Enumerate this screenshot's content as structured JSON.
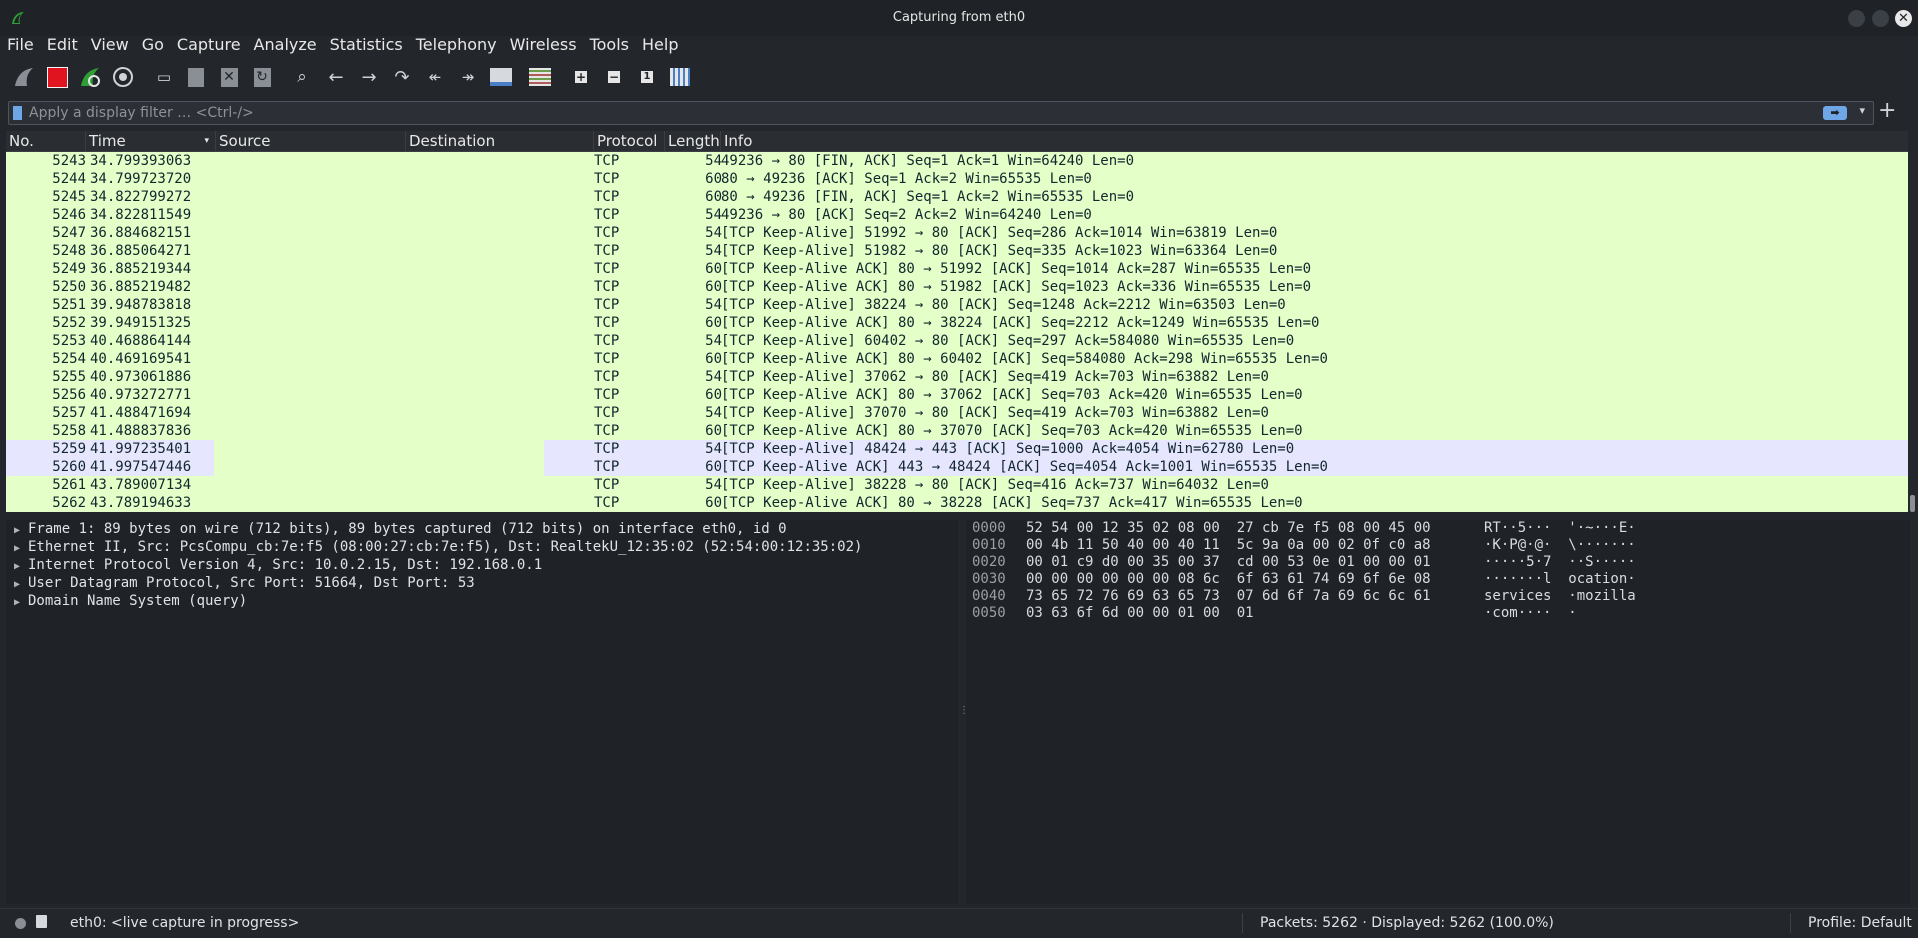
{
  "window": {
    "title": "Capturing from eth0"
  },
  "menu": [
    "File",
    "Edit",
    "View",
    "Go",
    "Capture",
    "Analyze",
    "Statistics",
    "Telephony",
    "Wireless",
    "Tools",
    "Help"
  ],
  "toolbar": {
    "icons": [
      "shark-fin-start-icon",
      "stop-capture-icon",
      "restart-capture-icon",
      "capture-options-icon",
      "open-file-icon",
      "save-file-icon",
      "close-file-icon",
      "reload-file-icon",
      "find-packet-icon",
      "go-back-icon",
      "go-forward-icon",
      "go-to-packet-icon",
      "first-packet-icon",
      "last-packet-icon",
      "autoscroll-icon",
      "colorize-icon",
      "zoom-in-icon",
      "zoom-out-icon",
      "normal-size-icon",
      "resize-columns-icon"
    ]
  },
  "filter": {
    "placeholder": "Apply a display filter … <Ctrl-/>"
  },
  "columns": {
    "no": "No.",
    "time": "Time",
    "source": "Source",
    "destination": "Destination",
    "protocol": "Protocol",
    "length": "Length",
    "info": "Info"
  },
  "packets": [
    {
      "no": "5243",
      "time": "34.799393063",
      "src": "",
      "dst": "",
      "proto": "TCP",
      "len": "54",
      "info": "49236 → 80 [FIN, ACK] Seq=1 Ack=1 Win=64240 Len=0"
    },
    {
      "no": "5244",
      "time": "34.799723720",
      "src": "",
      "dst": "",
      "proto": "TCP",
      "len": "60",
      "info": "80 → 49236 [ACK] Seq=1 Ack=2 Win=65535 Len=0"
    },
    {
      "no": "5245",
      "time": "34.822799272",
      "src": "",
      "dst": "",
      "proto": "TCP",
      "len": "60",
      "info": "80 → 49236 [FIN, ACK] Seq=1 Ack=2 Win=65535 Len=0"
    },
    {
      "no": "5246",
      "time": "34.822811549",
      "src": "",
      "dst": "",
      "proto": "TCP",
      "len": "54",
      "info": "49236 → 80 [ACK] Seq=2 Ack=2 Win=64240 Len=0"
    },
    {
      "no": "5247",
      "time": "36.884682151",
      "src": "",
      "dst": "",
      "proto": "TCP",
      "len": "54",
      "info": "[TCP Keep-Alive] 51992 → 80 [ACK] Seq=286 Ack=1014 Win=63819 Len=0"
    },
    {
      "no": "5248",
      "time": "36.885064271",
      "src": "",
      "dst": "",
      "proto": "TCP",
      "len": "54",
      "info": "[TCP Keep-Alive] 51982 → 80 [ACK] Seq=335 Ack=1023 Win=63364 Len=0"
    },
    {
      "no": "5249",
      "time": "36.885219344",
      "src": "",
      "dst": "",
      "proto": "TCP",
      "len": "60",
      "info": "[TCP Keep-Alive ACK] 80 → 51992 [ACK] Seq=1014 Ack=287 Win=65535 Len=0"
    },
    {
      "no": "5250",
      "time": "36.885219482",
      "src": "",
      "dst": "",
      "proto": "TCP",
      "len": "60",
      "info": "[TCP Keep-Alive ACK] 80 → 51982 [ACK] Seq=1023 Ack=336 Win=65535 Len=0"
    },
    {
      "no": "5251",
      "time": "39.948783818",
      "src": "",
      "dst": "",
      "proto": "TCP",
      "len": "54",
      "info": "[TCP Keep-Alive] 38224 → 80 [ACK] Seq=1248 Ack=2212 Win=63503 Len=0"
    },
    {
      "no": "5252",
      "time": "39.949151325",
      "src": "",
      "dst": "",
      "proto": "TCP",
      "len": "60",
      "info": "[TCP Keep-Alive ACK] 80 → 38224 [ACK] Seq=2212 Ack=1249 Win=65535 Len=0"
    },
    {
      "no": "5253",
      "time": "40.468864144",
      "src": "",
      "dst": "",
      "proto": "TCP",
      "len": "54",
      "info": "[TCP Keep-Alive] 60402 → 80 [ACK] Seq=297 Ack=584080 Win=65535 Len=0"
    },
    {
      "no": "5254",
      "time": "40.469169541",
      "src": "",
      "dst": "",
      "proto": "TCP",
      "len": "60",
      "info": "[TCP Keep-Alive ACK] 80 → 60402 [ACK] Seq=584080 Ack=298 Win=65535 Len=0"
    },
    {
      "no": "5255",
      "time": "40.973061886",
      "src": "",
      "dst": "",
      "proto": "TCP",
      "len": "54",
      "info": "[TCP Keep-Alive] 37062 → 80 [ACK] Seq=419 Ack=703 Win=63882 Len=0"
    },
    {
      "no": "5256",
      "time": "40.973272771",
      "src": "",
      "dst": "",
      "proto": "TCP",
      "len": "60",
      "info": "[TCP Keep-Alive ACK] 80 → 37062 [ACK] Seq=703 Ack=420 Win=65535 Len=0"
    },
    {
      "no": "5257",
      "time": "41.488471694",
      "src": "",
      "dst": "",
      "proto": "TCP",
      "len": "54",
      "info": "[TCP Keep-Alive] 37070 → 80 [ACK] Seq=419 Ack=703 Win=63882 Len=0"
    },
    {
      "no": "5258",
      "time": "41.488837836",
      "src": "",
      "dst": "",
      "proto": "TCP",
      "len": "60",
      "info": "[TCP Keep-Alive ACK] 80 → 37070 [ACK] Seq=703 Ack=420 Win=65535 Len=0"
    },
    {
      "no": "5259",
      "time": "41.997235401",
      "src": "",
      "dst": "",
      "proto": "TCP",
      "len": "54",
      "info": "[TCP Keep-Alive] 48424 → 443 [ACK] Seq=1000 Ack=4054 Win=62780 Len=0",
      "hl": true
    },
    {
      "no": "5260",
      "time": "41.997547446",
      "src": "",
      "dst": "",
      "proto": "TCP",
      "len": "60",
      "info": "[TCP Keep-Alive ACK] 443 → 48424 [ACK] Seq=4054 Ack=1001 Win=65535 Len=0",
      "hl": true
    },
    {
      "no": "5261",
      "time": "43.789007134",
      "src": "",
      "dst": "",
      "proto": "TCP",
      "len": "54",
      "info": "[TCP Keep-Alive] 38228 → 80 [ACK] Seq=416 Ack=737 Win=64032 Len=0"
    },
    {
      "no": "5262",
      "time": "43.789194633",
      "src": "",
      "dst": "",
      "proto": "TCP",
      "len": "60",
      "info": "[TCP Keep-Alive ACK] 80 → 38228 [ACK] Seq=737 Ack=417 Win=65535 Len=0"
    }
  ],
  "details": [
    "Frame 1: 89 bytes on wire (712 bits), 89 bytes captured (712 bits) on interface eth0, id 0",
    "Ethernet II, Src: PcsCompu_cb:7e:f5 (08:00:27:cb:7e:f5), Dst: RealtekU_12:35:02 (52:54:00:12:35:02)",
    "Internet Protocol Version 4, Src: 10.0.2.15, Dst: 192.168.0.1",
    "User Datagram Protocol, Src Port: 51664, Dst Port: 53",
    "Domain Name System (query)"
  ],
  "bytes": [
    {
      "off": "0000",
      "hex": "52 54 00 12 35 02 08 00  27 cb 7e f5 08 00 45 00",
      "ascii": "RT··5···  '·~···E·"
    },
    {
      "off": "0010",
      "hex": "00 4b 11 50 40 00 40 11  5c 9a 0a 00 02 0f c0 a8",
      "ascii": "·K·P@·@·  \\·······"
    },
    {
      "off": "0020",
      "hex": "00 01 c9 d0 00 35 00 37  cd 00 53 0e 01 00 00 01",
      "ascii": "·····5·7  ··S·····"
    },
    {
      "off": "0030",
      "hex": "00 00 00 00 00 00 08 6c  6f 63 61 74 69 6f 6e 08",
      "ascii": "·······l  ocation·"
    },
    {
      "off": "0040",
      "hex": "73 65 72 76 69 63 65 73  07 6d 6f 7a 69 6c 6c 61",
      "ascii": "services  ·mozilla"
    },
    {
      "off": "0050",
      "hex": "03 63 6f 6d 00 00 01 00  01",
      "ascii": "·com····  ·"
    }
  ],
  "status": {
    "message": "eth0: <live capture in progress>",
    "packets": "Packets: 5262 · Displayed: 5262 (100.0%)",
    "profile": "Profile: Default"
  },
  "colors": {
    "tcp_row": "#e4ffc7",
    "highlight_row": "#e7e6ff",
    "stop": "#e0141e",
    "accent": "#6fa6e6"
  }
}
